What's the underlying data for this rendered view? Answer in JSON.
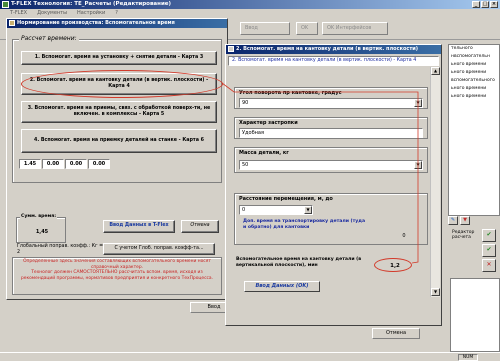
{
  "app": {
    "title": "T-FLEX Технология: TE_Расчеты (Редактирование)",
    "menu": [
      "Т-FLEX",
      "Документы",
      "Настройки",
      "?"
    ]
  },
  "toolbar": {
    "vvod": "Ввод",
    "ok": "OK",
    "ok_arrow": "OK Интерфейсов"
  },
  "background": {
    "list_items": [
      "тельного",
      "нвспомогательн",
      "ьного времени",
      "ьного времени",
      "вспомогательного",
      "ьного времени",
      "ьного времени"
    ],
    "redactor": "Редактор\nрасчета",
    "bottom_vvod": "Ввод",
    "bottom_otmena": "Отмена",
    "status_num": "NUM"
  },
  "dialog1": {
    "title": "Нормирование производства: Вспомогательное время",
    "group_caption": "Рассчет времени:",
    "cards": [
      "1. Вспомогат. время на установку + снятие детали - Карта 3",
      "2. Вспомогат. время на кантовку детали (в вертик. плоскости) - Карта 4",
      "3. Вспомогат. время на приемы, связ. с обработкой поверх-ти, не включен. в комплексы - Карта 5",
      "4. Вспомогат. время на приемку деталей на станке - Карта 6"
    ],
    "card_values": [
      "1.45",
      "0.00",
      "0.00",
      "0.00"
    ],
    "sum_label": "Сумм. время:",
    "sum_value": "1,45",
    "input_btn": "Ввод Данных в T-Flex",
    "cancel_btn": "Отмена",
    "global_label": "Глобальный поправ. коэфф.: Кг = 2",
    "global_btn": "С учетом Глоб. поправ. коэфф-та...",
    "warning": "Определенные здесь значения составляющих вспомогательного времени носят справочный характер.\nТехнолог должен САМОСТОЯТЕЛЬНО рассчитать вспом. время, исходя из рекомендаций программы, нормативов предприятия и конкретного ТехПроцесса.",
    "bottom_vvod": "Ввод"
  },
  "dialog2": {
    "title": "2. Вспомогат. время на кантовку детали (в вертик. плоскости)",
    "subtitle": "2. Вспомогат. время на кантовку детали (в вертик. плоскости) - Карта 4",
    "angle_label": "Угол поворота пр кантовке, градус",
    "angle_value": "90",
    "fixing_label": "Характер застропки",
    "fixing_value": "Удобная",
    "mass_label": "Масса детали, кг",
    "mass_value": "50",
    "distance_label": "Расстояние перемещения, м, до",
    "distance_value": "0",
    "transport_label": "Доп. время на транспортировку детали (туда и обратно) для кантовки",
    "transport_value": "0",
    "result_label": "Вспомогательное время на кантовку детали (в вертикальной плоскости), мин",
    "result_value": "1,2",
    "ok_btn": "Ввод Данных (OK)"
  },
  "colors": {
    "title_bar": "#0a246a",
    "highlight": "#d23a2a",
    "warning_text": "#c81e1e",
    "link_text": "#1a3aa0"
  }
}
